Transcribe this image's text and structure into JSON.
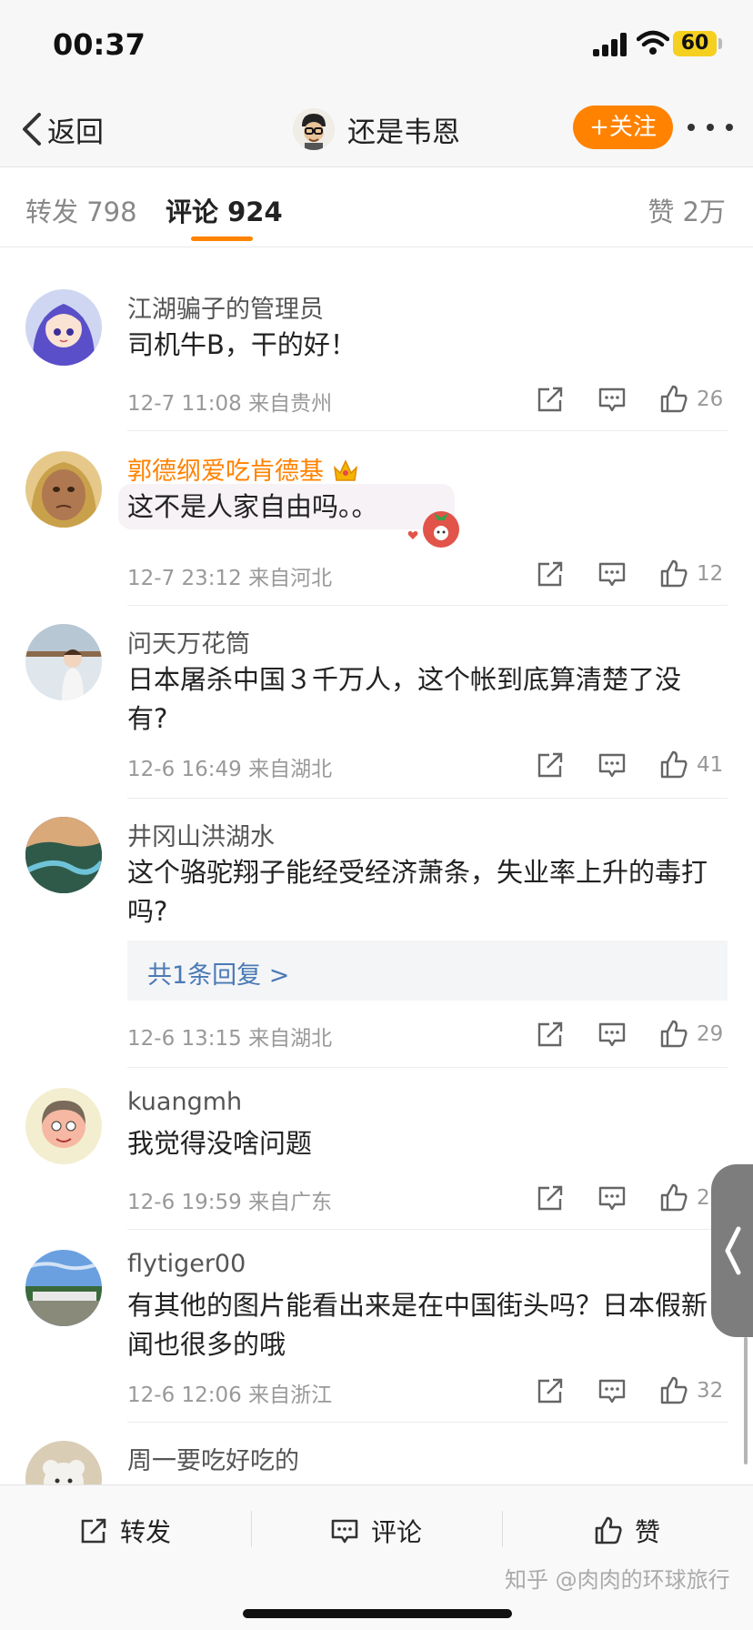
{
  "status": {
    "time": "00:37",
    "battery": "60"
  },
  "nav": {
    "back": "返回",
    "username": "还是韦恩",
    "follow": "+关注"
  },
  "tabs": {
    "repost": "转发 798",
    "comments": "评论 924",
    "likes": "赞 2万"
  },
  "comments": [
    {
      "name": "江湖骗子的管理员",
      "text": "司机牛B，干的好！",
      "time": "12-7 11:08",
      "location": "来自贵州",
      "likes": "26"
    },
    {
      "name": "郭德纲爱吃肯德基",
      "text": "这不是人家自由吗。。",
      "time": "12-7 23:12",
      "location": "来自河北",
      "likes": "12"
    },
    {
      "name": "问天万花筒",
      "text": "日本屠杀中国３千万人，这个帐到底算清楚了没有?",
      "time": "12-6 16:49",
      "location": "来自湖北",
      "likes": "41"
    },
    {
      "name": "井冈山洪湖水",
      "text": "这个骆驼翔子能经受经济萧条，失业率上升的毒打吗?",
      "reply": "共1条回复 >",
      "time": "12-6 13:15",
      "location": "来自湖北",
      "likes": "29"
    },
    {
      "name": "kuangmh",
      "text": "我觉得没啥问题",
      "time": "12-6 19:59",
      "location": "来自广东",
      "likes": "2"
    },
    {
      "name": "flytiger00",
      "text": "有其他的图片能看出来是在中国街头吗？日本假新闻也很多的哦",
      "time": "12-6 12:06",
      "location": "来自浙江",
      "likes": "32"
    },
    {
      "name": "周一要吃好吃的"
    }
  ],
  "bottom": {
    "repost": "转发",
    "comment": "评论",
    "like": "赞",
    "watermark": "知乎 @肉肉的环球旅行"
  },
  "colors": {
    "accent": "#ff8200",
    "link": "#4a79b5",
    "meta": "#999999"
  }
}
